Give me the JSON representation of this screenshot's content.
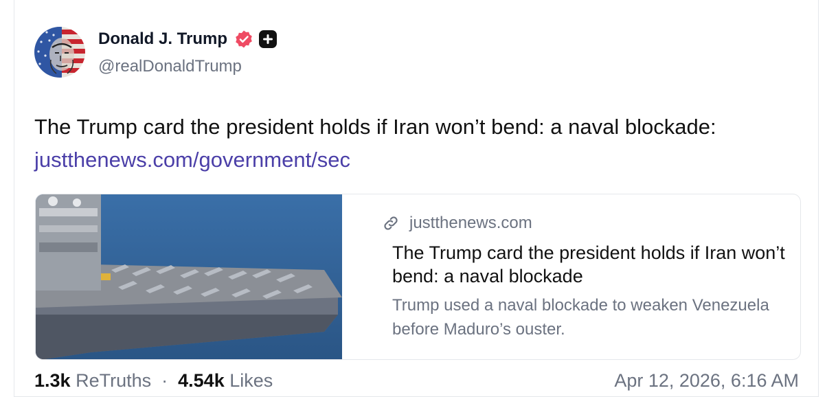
{
  "author": {
    "name": "Donald J. Trump",
    "handle": "@realDonaldTrump",
    "avatar_icon": "avatar-flag-portrait",
    "verified_icon": "verified-badge-icon",
    "verified_color": "#ef4b63",
    "badge_icon": "plus-square-icon"
  },
  "post": {
    "text": "The Trump card the president holds if Iran won’t bend: a naval blockade:",
    "link_text": "justthenews.com/government/sec",
    "link_color": "#4b3fa8"
  },
  "card": {
    "image_icon": "aircraft-carrier-photo",
    "link_icon": "link-icon",
    "domain": "justthenews.com",
    "title": "The Trump card the president holds if Iran won’t bend: a naval blockade",
    "description": "Trump used a naval blockade to weaken Venezuela before Maduro’s ouster."
  },
  "stats": {
    "retruths_count": "1.3k",
    "retruths_label": "ReTruths",
    "likes_count": "4.54k",
    "likes_label": "Likes",
    "timestamp": "Apr 12, 2026, 6:16 AM"
  }
}
